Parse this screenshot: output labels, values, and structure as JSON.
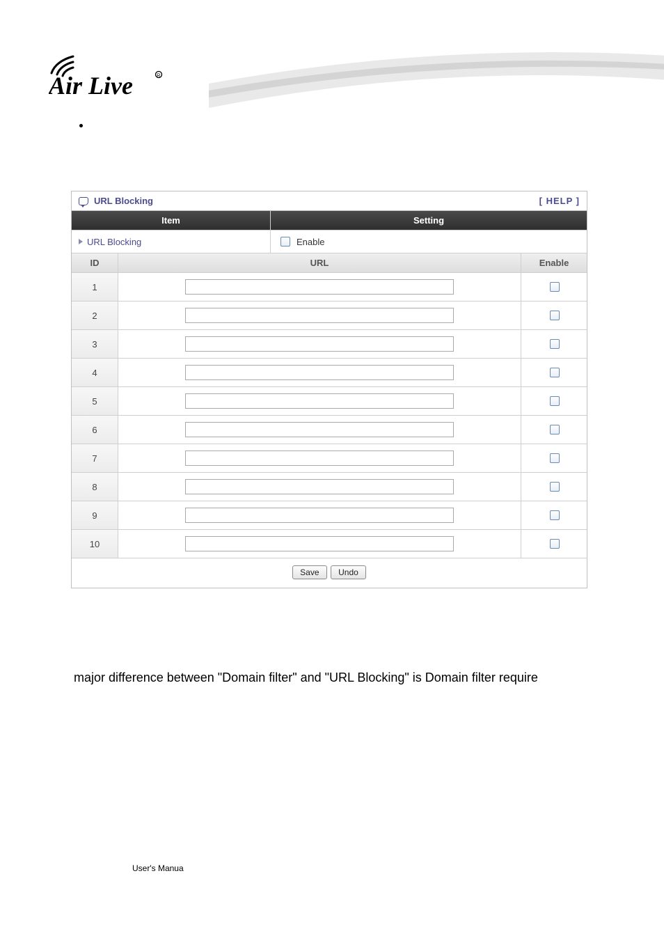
{
  "logo_text": "Air Live",
  "panel": {
    "title": "URL Blocking",
    "help_label": "[ HELP ]",
    "columns": {
      "item": "Item",
      "setting": "Setting"
    },
    "sub_item": "URL Blocking",
    "enable_checkbox_label": "Enable",
    "grid_headers": {
      "id": "ID",
      "url": "URL",
      "enable": "Enable"
    },
    "rows": [
      {
        "id": "1",
        "url": "",
        "enabled": false
      },
      {
        "id": "2",
        "url": "",
        "enabled": false
      },
      {
        "id": "3",
        "url": "",
        "enabled": false
      },
      {
        "id": "4",
        "url": "",
        "enabled": false
      },
      {
        "id": "5",
        "url": "",
        "enabled": false
      },
      {
        "id": "6",
        "url": "",
        "enabled": false
      },
      {
        "id": "7",
        "url": "",
        "enabled": false
      },
      {
        "id": "8",
        "url": "",
        "enabled": false
      },
      {
        "id": "9",
        "url": "",
        "enabled": false
      },
      {
        "id": "10",
        "url": "",
        "enabled": false
      }
    ],
    "buttons": {
      "save": "Save",
      "undo": "Undo"
    }
  },
  "body_paragraph": "major difference between \"Domain filter\" and \"URL Blocking\" is Domain filter require",
  "footer": "User's Manua"
}
